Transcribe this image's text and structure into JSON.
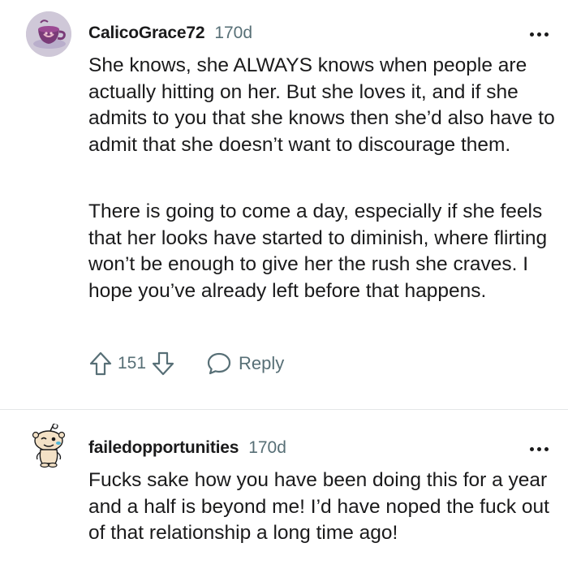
{
  "comments": [
    {
      "username": "CalicoGrace72",
      "age": "170d",
      "paragraphs": [
        "She knows, she ALWAYS knows when people are actually hitting on her. But she loves it, and if she admits to you that she knows then she’d also have to admit that she doesn’t want to discourage them.",
        "There is going to come a day, especially if she feels that her looks have started to diminish, where flirting won’t be enough to give her the rush she craves. I hope you’ve already left before that happens."
      ],
      "votes": "151",
      "reply_label": "Reply",
      "avatar_icon": "teacup-avatar-icon"
    },
    {
      "username": "failedopportunities",
      "age": "170d",
      "paragraphs": [
        "Fucks sake how you have been doing this for a year and a half is beyond me! I’d have noped the fuck out of that relationship a long time ago!"
      ],
      "avatar_icon": "snoo-avatar-icon"
    }
  ],
  "icons": {
    "upvote": "arrow-up-icon",
    "downvote": "arrow-down-icon",
    "reply": "speech-bubble-icon",
    "more": "more-options-icon"
  },
  "colors": {
    "text": "#1a1a1b",
    "meta": "#576f76",
    "divider": "#e4e6e8"
  }
}
